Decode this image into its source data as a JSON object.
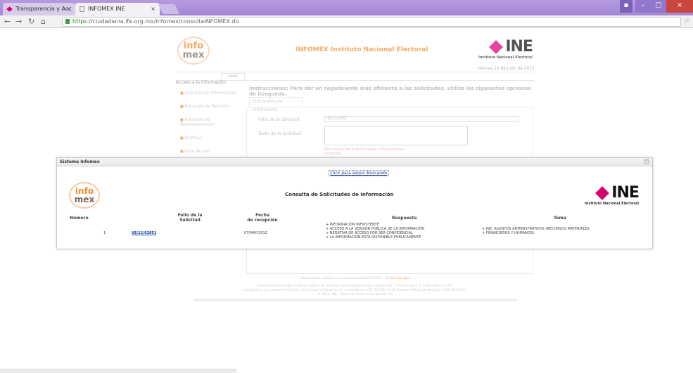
{
  "browser": {
    "tabs": [
      {
        "label": "Transparencia y Acc"
      },
      {
        "label": "INFOMEX INE"
      }
    ],
    "url_scheme": "https",
    "url_rest": "://ciudadania.ife.org.mx/infomex/consultaINFOMEX.do"
  },
  "page": {
    "logo": {
      "line1": "info",
      "line2": "mex"
    },
    "title": "INFOMEX Instituto Nacional Electoral",
    "ine": {
      "word": "INE",
      "sub": "Instituto Nacional Electoral"
    },
    "date": "viernes 10 de julio de 2015",
    "inicio": "Inicio",
    "sidebar": {
      "title": "Acceso a la Información",
      "items": [
        {
          "label": "Solicitud de Información"
        },
        {
          "label": "Recursos de Revisión"
        },
        {
          "label": "Recursos de Reconsideración"
        },
        {
          "label": "Gráficas"
        },
        {
          "label": "Guía de Uso"
        }
      ]
    },
    "instructions": "Instrucciones: Para dar un seguimiento más eficiente a las solicitudes, utiliza las siguientes opciones de búsqueda.",
    "subtab": "Solicitudes de Información",
    "form": {
      "folio_label": "Folio de la Solicitud:",
      "folio_value": "UE/12/2851",
      "texto_label": "Texto de la Solicitud:",
      "hint": "Para buscar en el texto tienes 150 caracteres restantes."
    },
    "footer": {
      "line1": "Sugerencias, quejas o comentarios sobre INFOMEX - INE",
      "link": "Da clic aquí",
      "line2": "Unidad de Enlace INE Viaducto Tlalpan No. 100 Col. Arenal Tepepan Del. Tlalpan Edif. C Primer Piso C.P. 14610 México, D.F.",
      "line3": "Contáctanos por correo electrónico: UE.transparencia@ine.mx, o al teléfono: (01) 55 5628 4400 Horario Módulo de Atención: 9:00-18:00 hrs.",
      "line4": "© 2014. INE - Derechos Reservados Versión 4.0"
    }
  },
  "modal": {
    "title": "Sistema Infomex",
    "search_link": "Click para seguir Buscando",
    "heading": "Consulta de Solicitudes de Información",
    "columns": {
      "numero": "Número",
      "folio_l1": "Folio de la",
      "folio_l2": "Solicitud",
      "fecha_l1": "Fecha",
      "fecha_l2": "de recepción",
      "respuesta": "Respuesta",
      "tema": "Tema"
    },
    "row": {
      "numero": "1",
      "folio": "UE/12/02851",
      "fecha": "07/MAY/2012",
      "respuesta": [
        "+ INFORMACIÓN INEXISTENTE",
        "+ ACCESO A LA VERSIÓN PÚBLICA DE LA INFORMACIÓN",
        "+ NEGATIVA DE ACCESO POR SER CONFIDENCIAL",
        "+ LA INFORMACIÓN ESTÁ DISPONIBLE PÚBLICAMENTE"
      ],
      "tema": [
        "+ INE. ASUNTOS ADMINISTRATIVOS (RECURSOS MATERIALES",
        "+ FINANCIEROS Y HUMANOS)."
      ]
    }
  },
  "colors": {
    "accent_orange": "#f08a2b",
    "ine_pink": "#d6006e",
    "tabbar": "#a487d6"
  }
}
